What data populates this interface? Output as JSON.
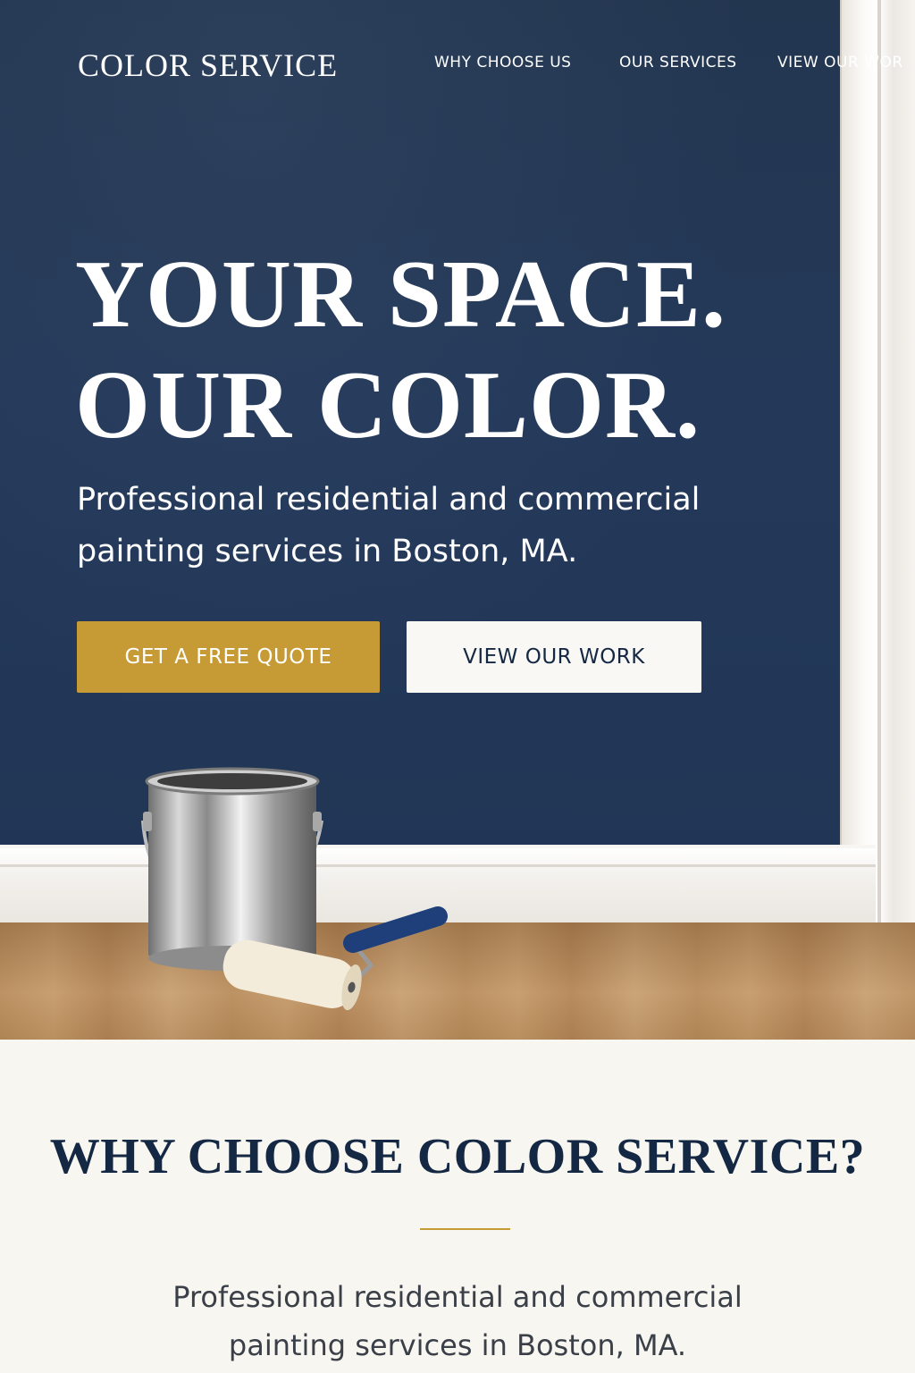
{
  "header": {
    "logo": "COLOR SERVICE",
    "nav": [
      {
        "label": "WHY CHOOSE US"
      },
      {
        "label": "OUR SERVICES"
      },
      {
        "label": "VIEW OUR WOR"
      }
    ]
  },
  "hero": {
    "headline_line1": "YOUR SPACE.",
    "headline_line2": "OUR COLOR.",
    "subheadline": "Professional residential and commercial painting services in Boston, MA.",
    "primary_button": "GET A FREE QUOTE",
    "secondary_button": "VIEW OUR WORK",
    "image_items": [
      "paint-can-icon",
      "paint-roller-icon"
    ]
  },
  "why_section": {
    "title": "WHY CHOOSE COLOR SERVICE?",
    "text": "Professional residential and commercial painting services in Boston, MA."
  },
  "colors": {
    "navy": "#233650",
    "gold": "#c69a34",
    "cream": "#f8f6f1",
    "dark_text": "#142843"
  }
}
